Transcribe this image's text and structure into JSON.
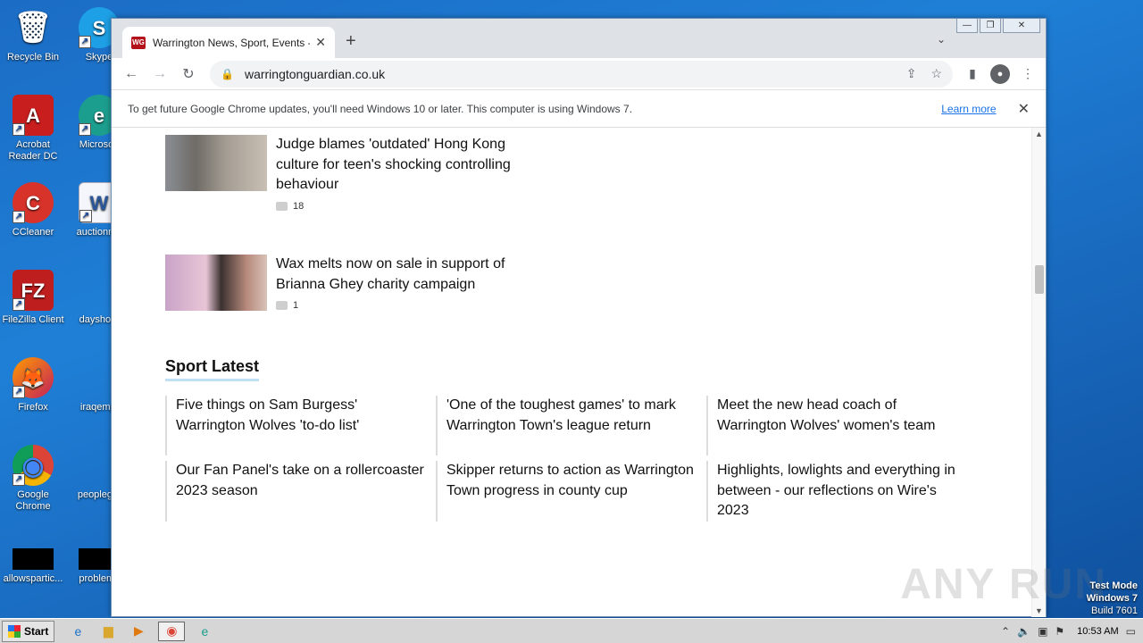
{
  "desktop": {
    "icons": [
      {
        "label": "Recycle Bin",
        "glyph": "🗑"
      },
      {
        "label": "Skype",
        "glyph": "S"
      },
      {
        "label": "Acrobat Reader DC",
        "glyph": "A"
      },
      {
        "label": "Microsoft",
        "glyph": "e"
      },
      {
        "label": "CCleaner",
        "glyph": "C"
      },
      {
        "label": "auctionme",
        "glyph": "W"
      },
      {
        "label": "FileZilla Client",
        "glyph": "FZ"
      },
      {
        "label": "dayshop.",
        "glyph": ""
      },
      {
        "label": "Firefox",
        "glyph": "🦊"
      },
      {
        "label": "iraqempl",
        "glyph": ""
      },
      {
        "label": "Google Chrome",
        "glyph": "◉"
      },
      {
        "label": "peopleget",
        "glyph": ""
      },
      {
        "label": "allowspartic...",
        "glyph": ""
      },
      {
        "label": "problems",
        "glyph": ""
      }
    ],
    "watermark": "ANY RUN",
    "test_mode": {
      "line1": "Test Mode",
      "line2": "Windows 7",
      "line3": "Build 7601"
    }
  },
  "browser": {
    "tab": {
      "favicon": "WG",
      "title": "Warrington News, Sport, Events - W"
    },
    "url": "warringtonguardian.co.uk",
    "infobar": {
      "message": "To get future Google Chrome updates, you'll need Windows 10 or later. This computer is using Windows 7.",
      "link": "Learn more"
    }
  },
  "page": {
    "articles": [
      {
        "title": "Judge blames 'outdated' Hong Kong culture for teen's shocking controlling behaviour",
        "comments": "18"
      },
      {
        "title": "Wax melts now on sale in support of Brianna Ghey charity campaign",
        "comments": "1"
      }
    ],
    "sport_section_title": "Sport Latest",
    "sport_items": [
      "Five things on Sam Burgess' Warrington Wolves 'to-do list'",
      "'One of the toughest games' to mark Warrington Town's league return",
      "Meet the new head coach of Warrington Wolves' women's team",
      "Our Fan Panel's take on a rollercoaster 2023 season",
      "Skipper returns to action as Warrington Town progress in county cup",
      "Highlights, lowlights and everything in between - our reflections on Wire's 2023"
    ]
  },
  "taskbar": {
    "start_label": "Start",
    "clock": "10:53 AM"
  },
  "colors": {
    "favicon_bg": "#b3121b",
    "link": "#1a73e8",
    "section_underline": "#bfe0f5"
  }
}
